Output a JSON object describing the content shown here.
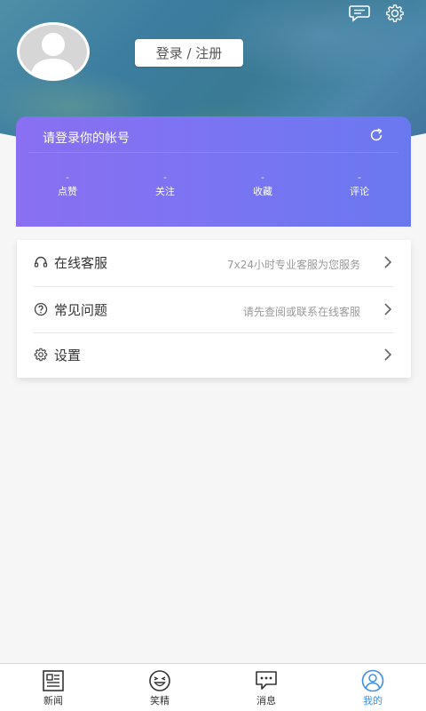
{
  "header": {
    "login_label": "登录 / 注册",
    "icons": [
      "message-icon",
      "settings-gear-icon"
    ]
  },
  "account_card": {
    "title": "请登录你的帐号",
    "stats": [
      {
        "value": "-",
        "label": "点赞"
      },
      {
        "value": "-",
        "label": "关注"
      },
      {
        "value": "-",
        "label": "收藏"
      },
      {
        "value": "-",
        "label": "评论"
      }
    ],
    "colors": {
      "gradient_start": "#8a6ff2",
      "gradient_end": "#6a78f0"
    }
  },
  "menu": [
    {
      "label": "在线客服",
      "desc": "7x24小时专业客服为您服务",
      "icon": "headset-icon"
    },
    {
      "label": "常见问题",
      "desc": "请先查阅或联系在线客服",
      "icon": "question-circle-icon"
    },
    {
      "label": "设置",
      "desc": "",
      "icon": "gear-icon"
    }
  ],
  "tabbar": {
    "tabs": [
      {
        "label": "新闻",
        "icon": "newspaper-icon"
      },
      {
        "label": "笑精",
        "icon": "laughing-face-icon"
      },
      {
        "label": "消息",
        "icon": "chat-bubble-icon"
      },
      {
        "label": "我的",
        "icon": "user-profile-icon"
      }
    ],
    "active_index": 3,
    "active_color": "#3f8fe0"
  }
}
